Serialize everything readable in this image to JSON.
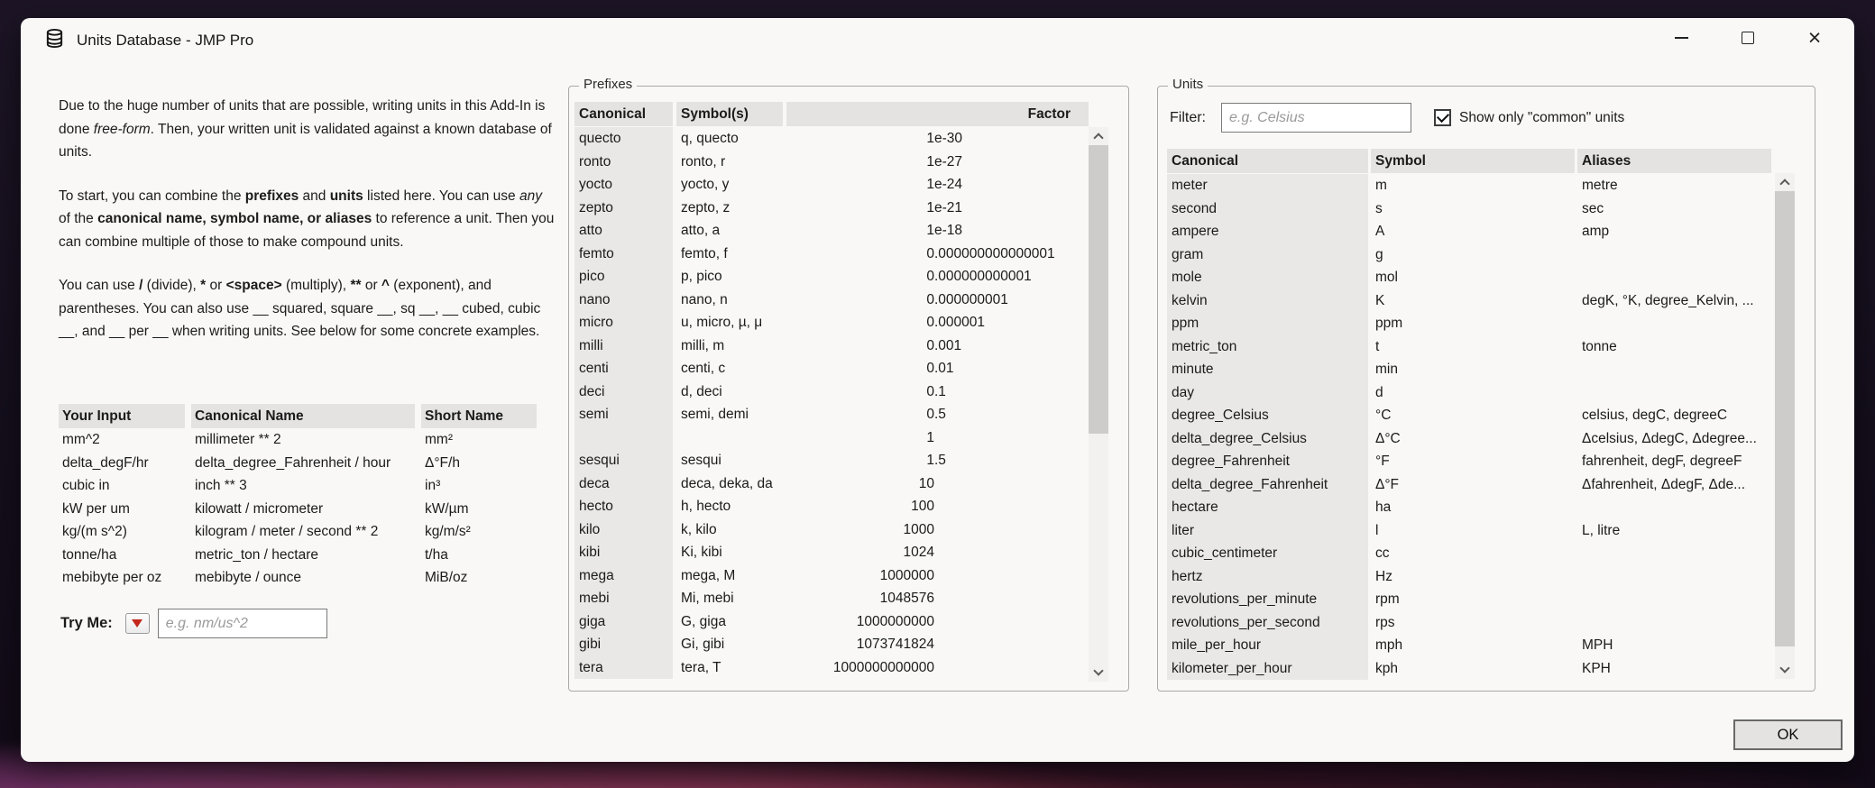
{
  "window": {
    "title": "Units Database - JMP Pro",
    "icons": {
      "titlebar": "database-icon",
      "controls": [
        "minimize-icon",
        "maximize-icon",
        "close-icon"
      ]
    }
  },
  "colors": {
    "window_bg": "#f9f8f7",
    "header_gray": "#e4e3e2",
    "column_gray": "#e9e8e7",
    "dropdown_arrow_red": "#c3271b"
  },
  "intro": {
    "paragraphs": [
      [
        {
          "t": "Due to the huge number of units that are possible, writing units in this Add-In is done "
        },
        {
          "t": "free-form",
          "i": true
        },
        {
          "t": ". Then, your written unit is validated against a known database of units."
        }
      ],
      [
        {
          "t": "To start, you can combine the "
        },
        {
          "t": "prefixes",
          "b": true
        },
        {
          "t": " and "
        },
        {
          "t": "units",
          "b": true
        },
        {
          "t": " listed here. You can use "
        },
        {
          "t": "any",
          "i": true
        },
        {
          "t": " of the "
        },
        {
          "t": "canonical name, symbol name, or aliases",
          "b": true
        },
        {
          "t": " to reference a unit. Then you can combine multiple of those to make compound units."
        }
      ],
      [
        {
          "t": "You can use "
        },
        {
          "t": "/",
          "b": true
        },
        {
          "t": " (divide), "
        },
        {
          "t": "*",
          "b": true
        },
        {
          "t": " or "
        },
        {
          "t": "<space>",
          "b": true
        },
        {
          "t": " (multiply), "
        },
        {
          "t": "**",
          "b": true
        },
        {
          "t": " or "
        },
        {
          "t": "^",
          "b": true
        },
        {
          "t": " (exponent), and parentheses. You can also use __ squared, square __, sq __, __ cubed, cubic __, and __ per __ when writing units. See below for some concrete examples."
        }
      ]
    ]
  },
  "examples": {
    "headers": [
      "Your Input",
      "Canonical Name",
      "Short Name"
    ],
    "rows": [
      [
        "mm^2",
        "millimeter ** 2",
        "mm²"
      ],
      [
        "delta_degF/hr",
        "delta_degree_Fahrenheit / hour",
        "Δ°F/h"
      ],
      [
        "cubic in",
        "inch ** 3",
        "in³"
      ],
      [
        "kW per um",
        "kilowatt / micrometer",
        "kW/µm"
      ],
      [
        "kg/(m s^2)",
        "kilogram / meter / second ** 2",
        "kg/m/s²"
      ],
      [
        "tonne/ha",
        "metric_ton / hectare",
        "t/ha"
      ],
      [
        "mebibyte per oz",
        "mebibyte / ounce",
        "MiB/oz"
      ]
    ]
  },
  "try_me": {
    "label": "Try Me:",
    "placeholder": "e.g. nm/us^2"
  },
  "prefixes": {
    "group_label": "Prefixes",
    "headers": [
      "Canonical",
      "Symbol(s)",
      "Factor"
    ],
    "rows": [
      [
        "quecto",
        "q, quecto",
        "1e-30"
      ],
      [
        "ronto",
        "ronto, r",
        "1e-27"
      ],
      [
        "yocto",
        "yocto, y",
        "1e-24"
      ],
      [
        "zepto",
        "zepto, z",
        "1e-21"
      ],
      [
        "atto",
        "atto, a",
        "1e-18"
      ],
      [
        "femto",
        "femto, f",
        "0.000000000000001"
      ],
      [
        "pico",
        "p, pico",
        "0.000000000001"
      ],
      [
        "nano",
        "nano, n",
        "0.000000001"
      ],
      [
        "micro",
        "u, micro, µ, μ",
        "0.000001"
      ],
      [
        "milli",
        "milli, m",
        "0.001"
      ],
      [
        "centi",
        "centi, c",
        "0.01"
      ],
      [
        "deci",
        "d, deci",
        "0.1"
      ],
      [
        "semi",
        "semi, demi",
        "0.5"
      ],
      [
        "",
        "",
        "1"
      ],
      [
        "sesqui",
        "sesqui",
        "1.5"
      ],
      [
        "deca",
        "deca, deka, da",
        "10"
      ],
      [
        "hecto",
        "h, hecto",
        "100"
      ],
      [
        "kilo",
        "k, kilo",
        "1000"
      ],
      [
        "kibi",
        "Ki, kibi",
        "1024"
      ],
      [
        "mega",
        "mega, M",
        "1000000"
      ],
      [
        "mebi",
        "Mi, mebi",
        "1048576"
      ],
      [
        "giga",
        "G, giga",
        "1000000000"
      ],
      [
        "gibi",
        "Gi, gibi",
        "1073741824"
      ],
      [
        "tera",
        "tera, T",
        "1000000000000"
      ]
    ]
  },
  "units": {
    "group_label": "Units",
    "filter_label": "Filter:",
    "filter_placeholder": "e.g. Celsius",
    "checkbox_label": "Show only \"common\" units",
    "checkbox_checked": true,
    "headers": [
      "Canonical",
      "Symbol",
      "Aliases"
    ],
    "rows": [
      [
        "meter",
        "m",
        "metre"
      ],
      [
        "second",
        "s",
        "sec"
      ],
      [
        "ampere",
        "A",
        "amp"
      ],
      [
        "gram",
        "g",
        ""
      ],
      [
        "mole",
        "mol",
        ""
      ],
      [
        "kelvin",
        "K",
        "degK, °K, degree_Kelvin, ..."
      ],
      [
        "ppm",
        "ppm",
        ""
      ],
      [
        "metric_ton",
        "t",
        "tonne"
      ],
      [
        "minute",
        "min",
        ""
      ],
      [
        "day",
        "d",
        ""
      ],
      [
        "degree_Celsius",
        "°C",
        "celsius, degC, degreeC"
      ],
      [
        "delta_degree_Celsius",
        "Δ°C",
        "Δcelsius, ΔdegC, Δdegree..."
      ],
      [
        "degree_Fahrenheit",
        "°F",
        "fahrenheit, degF, degreeF"
      ],
      [
        "delta_degree_Fahrenheit",
        "Δ°F",
        "Δfahrenheit, ΔdegF, Δde..."
      ],
      [
        "hectare",
        "ha",
        ""
      ],
      [
        "liter",
        "l",
        "L, litre"
      ],
      [
        "cubic_centimeter",
        "cc",
        ""
      ],
      [
        "hertz",
        "Hz",
        ""
      ],
      [
        "revolutions_per_minute",
        "rpm",
        ""
      ],
      [
        "revolutions_per_second",
        "rps",
        ""
      ],
      [
        "mile_per_hour",
        "mph",
        "MPH"
      ],
      [
        "kilometer_per_hour",
        "kph",
        "KPH"
      ]
    ]
  },
  "ok_button": "OK"
}
